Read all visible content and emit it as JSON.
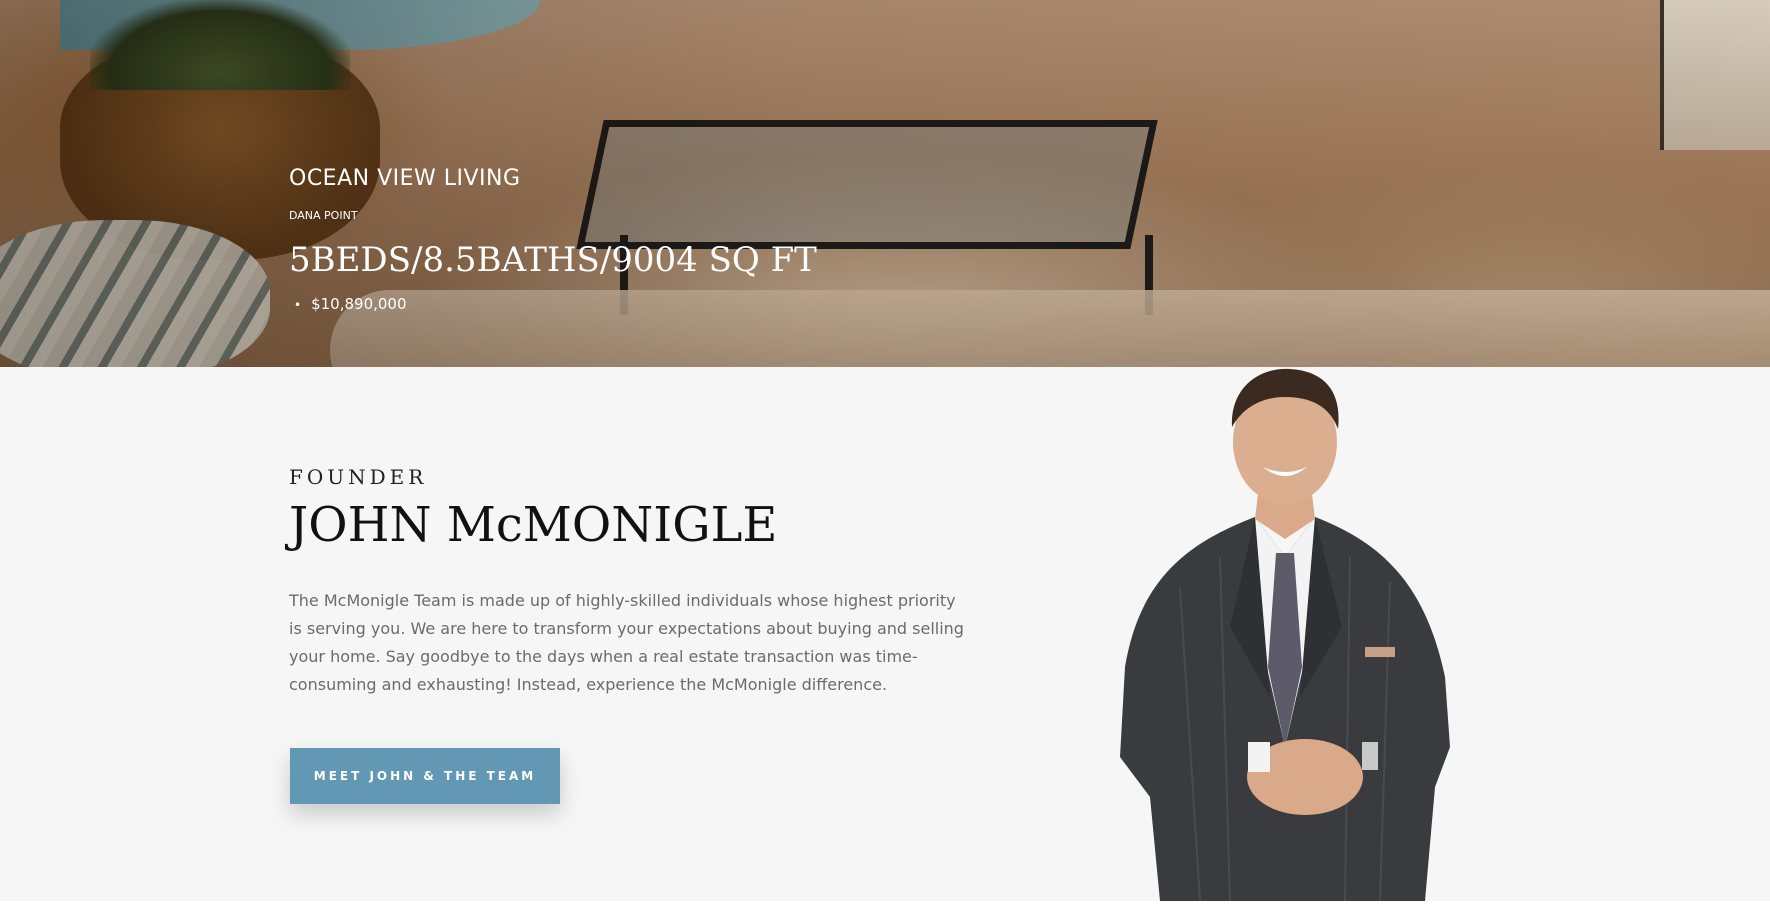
{
  "listing": {
    "title": "OCEAN VIEW LIVING",
    "city": "DANA POINT",
    "specs": "5BEDS/8.5BATHS/9004 SQ FT",
    "bullet": "•",
    "price": "$10,890,000"
  },
  "founder": {
    "eyebrow": "FOUNDER",
    "name": "JOHN McMONIGLE",
    "bio": "The McMonigle Team is made up of highly-skilled individuals whose highest priority is serving you. We are here to transform your expectations about buying and selling your home. Say goodbye to the days when a real estate transaction was time-consuming and exhausting! Instead, experience the McMonigle difference.",
    "button_label": "MEET JOHN & THE TEAM"
  },
  "colors": {
    "accent": "#6298b3",
    "section_bg": "#f6f6f6"
  }
}
